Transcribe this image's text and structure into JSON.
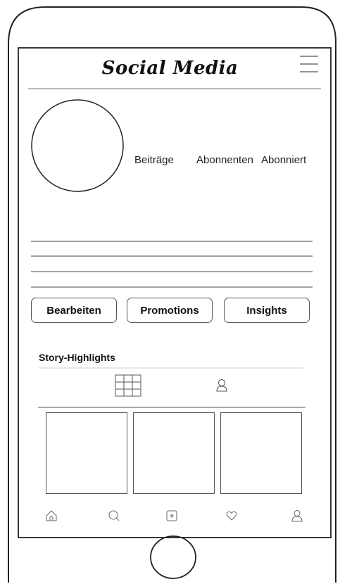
{
  "header": {
    "title": "Social Media",
    "menu_icon": "hamburger-menu-icon"
  },
  "profile": {
    "avatar_icon": "profile-picture-placeholder",
    "stats": {
      "posts_label": "Beiträge",
      "followers_label": "Abonnenten",
      "following_label": "Abonniert"
    }
  },
  "actions": {
    "edit_label": "Bearbeiten",
    "promotions_label": "Promotions",
    "insights_label": "Insights"
  },
  "highlights": {
    "title": "Story-Highlights"
  },
  "tabs": [
    {
      "icon": "grid-icon",
      "selected": true
    },
    {
      "icon": "tagged-user-icon",
      "selected": false
    }
  ],
  "bottom_nav": [
    {
      "icon": "home-icon"
    },
    {
      "icon": "search-icon"
    },
    {
      "icon": "add-post-icon"
    },
    {
      "icon": "heart-icon"
    },
    {
      "icon": "profile-icon"
    }
  ],
  "colors": {
    "line": "#555555",
    "text": "#222222",
    "background": "#ffffff"
  }
}
